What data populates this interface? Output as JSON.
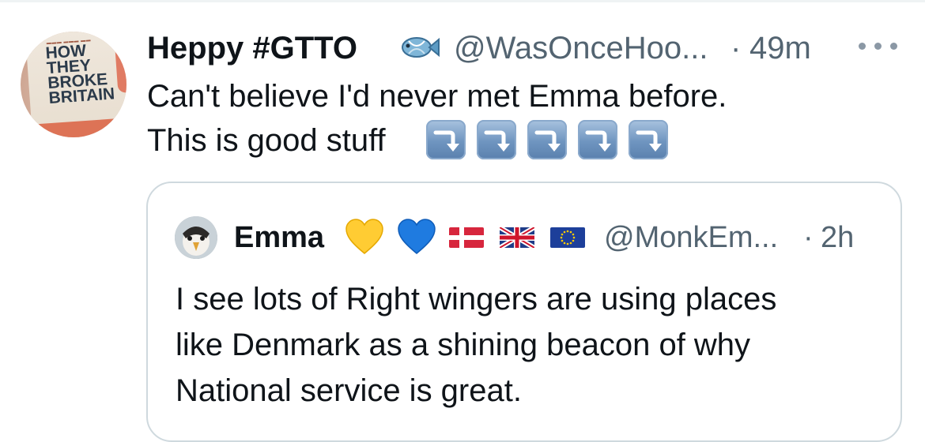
{
  "tweet": {
    "display_name": "Heppy #GTTO",
    "name_emoji": "fish-icon",
    "handle": "@WasOnceHoo...",
    "separator": "·",
    "time": "49m",
    "text_line1": "Can't believe I'd never met Emma before.",
    "text_line2": "This is good stuff",
    "trailing_emoji": [
      "right-arrow-curving-down-icon",
      "right-arrow-curving-down-icon",
      "right-arrow-curving-down-icon",
      "right-arrow-curving-down-icon",
      "right-arrow-curving-down-icon"
    ],
    "avatar_book_lines": [
      "HOW",
      "THEY",
      "BROKE",
      "BRITAIN"
    ]
  },
  "quoted": {
    "display_name": "Emma",
    "name_emojis": [
      "yellow-heart-icon",
      "blue-heart-icon",
      "denmark-flag-icon",
      "uk-flag-icon",
      "eu-flag-icon"
    ],
    "handle": "@MonkEm...",
    "separator": "·",
    "time": "2h",
    "text_lines": [
      "I see lots of Right wingers are using places",
      "like Denmark as a shining beacon of why",
      "National service is great."
    ]
  },
  "colors": {
    "primary_text": "#0f1419",
    "secondary_text": "#536471",
    "border": "#cfd9de"
  }
}
